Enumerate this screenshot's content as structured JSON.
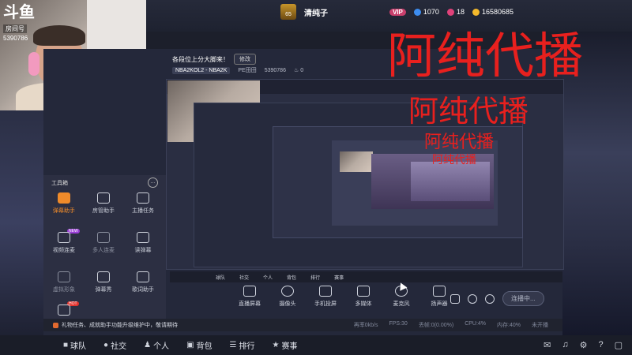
{
  "webcam": {
    "channel_logo": "斗鱼",
    "room_label": "房间号",
    "room_id": "5390786"
  },
  "top_bar": {
    "level": "65",
    "username": "清纯子",
    "vip": "VIP",
    "fish_balls": "1070",
    "fish_fins": "18",
    "coins": "16580685"
  },
  "watermarks": [
    "阿纯代播",
    "阿纯代播",
    "阿纯代播",
    "阿纯代播"
  ],
  "stream_panel": {
    "title": "各段位上分大脚来！",
    "edit_label": "修改",
    "category": "NBA2KOL2 - NBA2K",
    "platform": "PE田田",
    "room_id": "5390786",
    "heat": "0"
  },
  "toolbox": {
    "title": "工具箱",
    "more_icon": "more-icon",
    "tools": [
      {
        "label": "弹幕助手",
        "icon": "danmaku-assistant-icon",
        "active": true
      },
      {
        "label": "房管助手",
        "icon": "room-manager-icon"
      },
      {
        "label": "主播任务",
        "icon": "task-icon"
      },
      {
        "label": "视频连麦",
        "icon": "video-link-icon",
        "badge": "NEW"
      },
      {
        "label": "多人连麦",
        "icon": "multi-link-icon",
        "dim": true
      },
      {
        "label": "读弹幕",
        "icon": "read-danmaku-icon"
      },
      {
        "label": "虚拟形象",
        "icon": "avatar-icon",
        "dim": true
      },
      {
        "label": "弹幕秀",
        "icon": "danmaku-show-icon"
      },
      {
        "label": "歌词助手",
        "icon": "lyrics-icon"
      },
      {
        "label": "",
        "icon": "gift-icon",
        "badge": "HOT"
      }
    ]
  },
  "mid_nav": [
    "球队",
    "社交",
    "个人",
    "背包",
    "排行",
    "赛事"
  ],
  "controls": [
    {
      "label": "直播屏幕",
      "icon": "screen-icon"
    },
    {
      "label": "摄像头",
      "icon": "camera-icon"
    },
    {
      "label": "手机投屏",
      "icon": "phone-cast-icon"
    },
    {
      "label": "多媒体",
      "icon": "media-icon"
    },
    {
      "label": "麦克风",
      "icon": "microphone-icon"
    },
    {
      "label": "扬声器",
      "icon": "speaker-icon"
    }
  ],
  "live_button": "连播中...",
  "status": {
    "notice": "礼物任务、成就助手功能升级维护中，敬请期待",
    "upload": "再率0kb/s",
    "fps": "FPS:30",
    "dropped": "丢帧:0(0.00%)",
    "cpu": "CPU:4%",
    "memory": "内存:40%",
    "recording": "未开播"
  },
  "bottom_nav": [
    {
      "label": "球队",
      "icon": "team-icon"
    },
    {
      "label": "社交",
      "icon": "social-icon"
    },
    {
      "label": "个人",
      "icon": "person-icon"
    },
    {
      "label": "背包",
      "icon": "bag-icon"
    },
    {
      "label": "排行",
      "icon": "rank-icon"
    },
    {
      "label": "赛事",
      "icon": "trophy-icon"
    }
  ],
  "colors": {
    "watermark": "#e8201e",
    "accent": "#f08b2a",
    "panel": "#24283a"
  }
}
